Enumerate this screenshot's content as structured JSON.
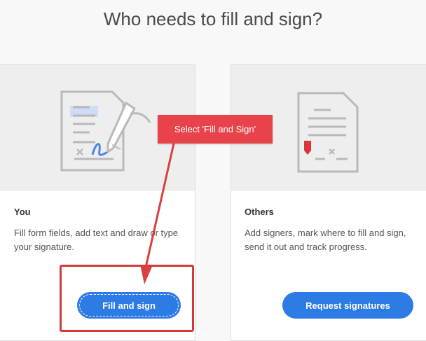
{
  "page": {
    "title": "Who needs to fill and sign?"
  },
  "cards": {
    "you": {
      "heading": "You",
      "description": "Fill form fields, add text and draw or type your signature.",
      "button_label": "Fill and sign"
    },
    "others": {
      "heading": "Others",
      "description": "Add signers, mark where to fill and sign, send it out and track progress.",
      "button_label": "Request signatures"
    }
  },
  "annotation": {
    "callout_text": "Select 'Fill and Sign'"
  },
  "colors": {
    "button_blue": "#2d7be5",
    "annotation_red": "#e8434a",
    "frame_red": "#d43a3a",
    "illustration_blue": "#4f86e8",
    "signature_red": "#d9363e"
  }
}
